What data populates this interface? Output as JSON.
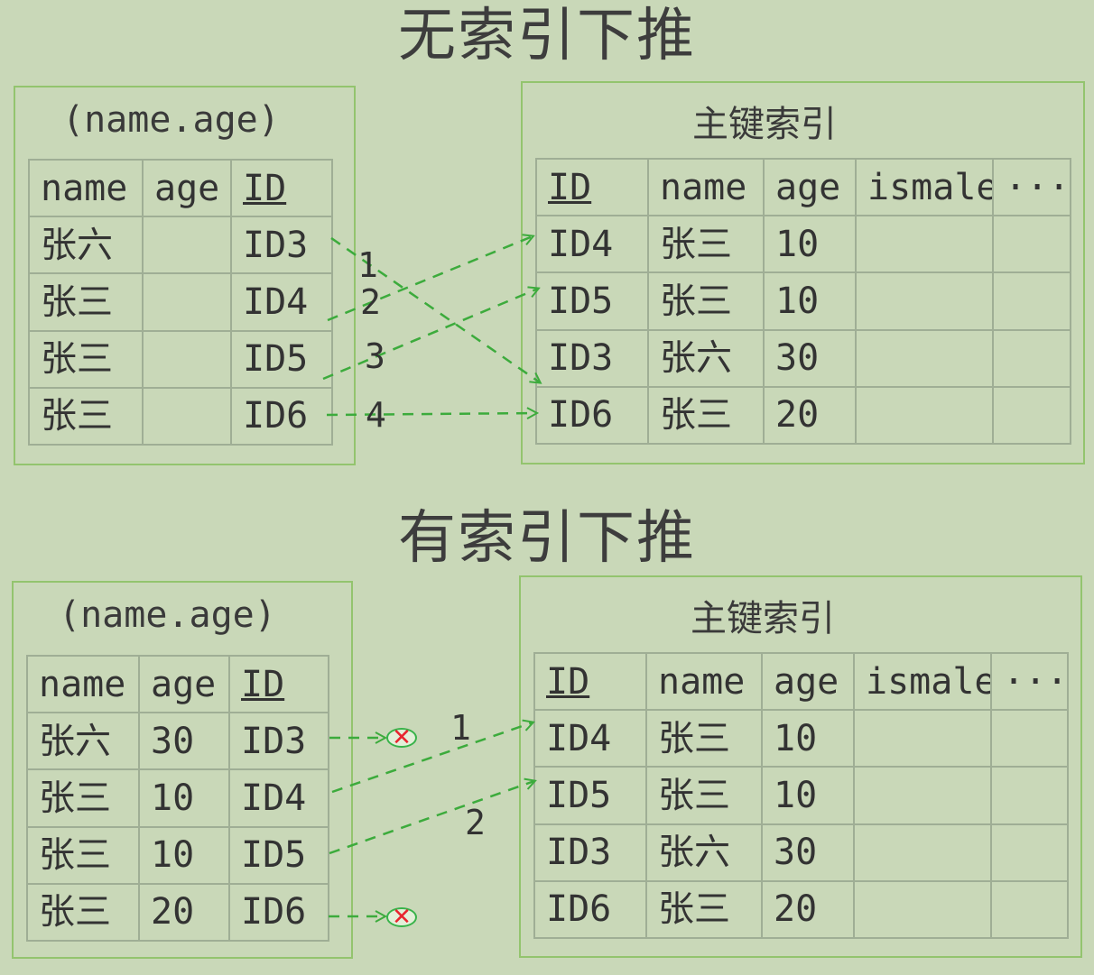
{
  "top": {
    "heading": "无索引下推",
    "left_title": "(name.age)",
    "right_title": "主键索引",
    "left_table": {
      "headers": [
        "name",
        "age",
        "ID"
      ],
      "rows": [
        [
          "张六",
          "",
          "ID3"
        ],
        [
          "张三",
          "",
          "ID4"
        ],
        [
          "张三",
          "",
          "ID5"
        ],
        [
          "张三",
          "",
          "ID6"
        ]
      ]
    },
    "right_table": {
      "headers": [
        "ID",
        "name",
        "age",
        "ismale",
        "···"
      ],
      "rows": [
        [
          "ID4",
          "张三",
          "10",
          "",
          ""
        ],
        [
          "ID5",
          "张三",
          "10",
          "",
          ""
        ],
        [
          "ID3",
          "张六",
          "30",
          "",
          ""
        ],
        [
          "ID6",
          "张三",
          "20",
          "",
          ""
        ]
      ]
    },
    "arrow_labels": [
      "1",
      "2",
      "3",
      "4"
    ]
  },
  "bottom": {
    "heading": "有索引下推",
    "left_title": "(name.age)",
    "right_title": "主键索引",
    "left_table": {
      "headers": [
        "name",
        "age",
        "ID"
      ],
      "rows": [
        [
          "张六",
          "30",
          "ID3"
        ],
        [
          "张三",
          "10",
          "ID4"
        ],
        [
          "张三",
          "10",
          "ID5"
        ],
        [
          "张三",
          "20",
          "ID6"
        ]
      ]
    },
    "right_table": {
      "headers": [
        "ID",
        "name",
        "age",
        "ismale",
        "···"
      ],
      "rows": [
        [
          "ID4",
          "张三",
          "10",
          "",
          ""
        ],
        [
          "ID5",
          "张三",
          "10",
          "",
          ""
        ],
        [
          "ID3",
          "张六",
          "30",
          "",
          ""
        ],
        [
          "ID6",
          "张三",
          "20",
          "",
          ""
        ]
      ]
    },
    "arrow_labels": [
      "1",
      "2"
    ],
    "rejected_icon": "crossed-circle-icon"
  },
  "colors": {
    "background": "#c9d8b8",
    "panel_border": "#93c46e",
    "arrow": "#3cab3c",
    "reject_mark": "#e8242e"
  }
}
